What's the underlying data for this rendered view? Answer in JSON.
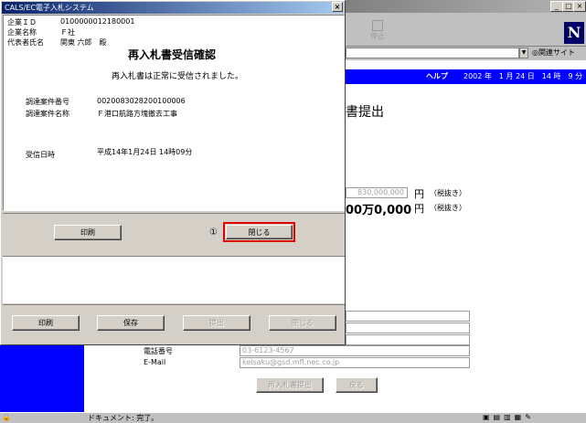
{
  "browser": {
    "status_text": "ドキュメント: 完了。",
    "netscape_logo": "N",
    "related_sites": "関連サイト",
    "toolbar_stop": "停止",
    "title_controls": [
      "_",
      "□",
      "×"
    ]
  },
  "page": {
    "header_help": "ヘルプ",
    "header_date": "2002 年　1 月 24 日　14 時　9 分",
    "title_partial": "書提出",
    "amount_input": "830,000,000",
    "amount_unit": "円",
    "amount_tax": "（税抜き）",
    "amount_kanji": "00万0,000",
    "amount_kanji_unit": "円",
    "amount_kanji_tax": "（税抜き）",
    "phone_label": "電話番号",
    "phone_value": "03-6123-4567",
    "email_label": "E-Mail",
    "email_value": "keisaku@gsd.mfl.nec.co.jp",
    "submit_button": "再入札書提出",
    "back_button": "戻る"
  },
  "dialog": {
    "title": "CALS/EC電子入札システム",
    "company_id_label": "企業ＩＤ",
    "company_id_value": "0100000012180001",
    "company_name_label": "企業名称",
    "company_name_value": "Ｆ社",
    "rep_label": "代表者氏名",
    "rep_value": "関東 六郎　殿",
    "heading": "再入札書受信確認",
    "message": "再入札書は正常に受信されました。",
    "proc_no_label": "調達案件番号",
    "proc_no_value": "0020083028200100006",
    "proc_name_label": "調達案件名称",
    "proc_name_value": "Ｆ港口航路方塊撤去工事",
    "recv_label": "受信日時",
    "recv_value": "平成14年1月24日 14時09分",
    "print_button": "印刷",
    "annotation": "①",
    "close_button": "閉じる",
    "bottom_print": "印刷",
    "bottom_save": "保存",
    "bottom_submit": "提出",
    "bottom_close": "閉じる",
    "close_x": "×"
  },
  "colors": {
    "blue": "#0000ff",
    "titlebar_start": "#0a246a",
    "titlebar_end": "#a6caf0",
    "highlight_red": "#e00000"
  }
}
